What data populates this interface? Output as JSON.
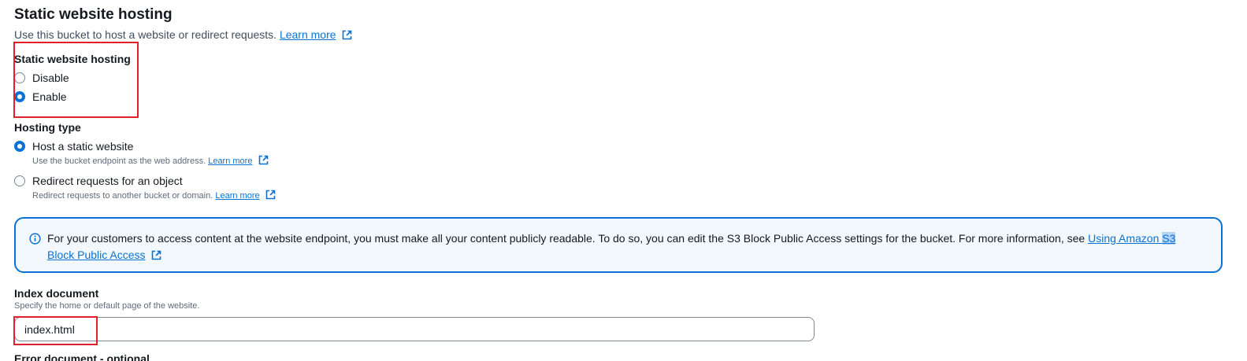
{
  "section": {
    "title": "Static website hosting",
    "description": "Use this bucket to host a website or redirect requests.",
    "learn_more": "Learn more"
  },
  "hosting_toggle": {
    "label": "Static website hosting",
    "options": [
      {
        "label": "Disable",
        "selected": false
      },
      {
        "label": "Enable",
        "selected": true
      }
    ]
  },
  "hosting_type": {
    "label": "Hosting type",
    "options": [
      {
        "label": "Host a static website",
        "description": "Use the bucket endpoint as the web address.",
        "learn_more": "Learn more",
        "selected": true
      },
      {
        "label": "Redirect requests for an object",
        "description": "Redirect requests to another bucket or domain.",
        "learn_more": "Learn more",
        "selected": false
      }
    ]
  },
  "info_alert": {
    "text": "For your customers to access content at the website endpoint, you must make all your content publicly readable. To do so, you can edit the S3 Block Public Access settings for the bucket. For more information, see",
    "link_part1": "Using Amazon ",
    "link_part2": "S3",
    "link_part3": "Block Public Access"
  },
  "index_document": {
    "label": "Index document",
    "description": "Specify the home or default page of the website.",
    "value": "index.html"
  },
  "next_label": "Error document - optional",
  "colors": {
    "accent": "#0972d3",
    "highlight": "#e3202a",
    "info_bg": "#f2f8fd"
  }
}
